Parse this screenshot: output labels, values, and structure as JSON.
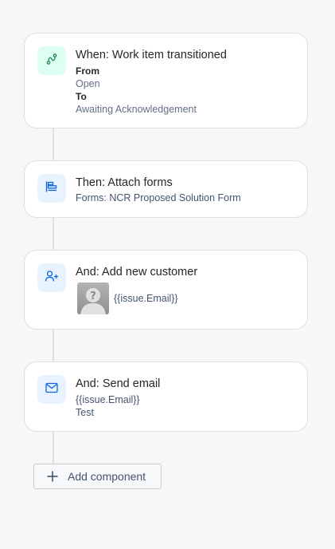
{
  "steps": [
    {
      "title": "When: Work item transitioned",
      "from_label": "From",
      "from_value": "Open",
      "to_label": "To",
      "to_value": "Awaiting Acknowledgement",
      "icon": "transition-icon"
    },
    {
      "title": "Then: Attach forms",
      "detail": "Forms: NCR Proposed Solution Form",
      "icon": "forms-icon"
    },
    {
      "title": "And: Add new customer",
      "detail": "{{issue.Email}}",
      "icon": "add-user-icon",
      "avatar": "default-avatar-icon"
    },
    {
      "title": "And: Send email",
      "recipient": "{{issue.Email}}",
      "subject": "Test",
      "icon": "mail-icon"
    }
  ],
  "add_component": {
    "label": "Add component",
    "icon": "plus-icon"
  },
  "colors": {
    "trigger_icon": "#1f845a",
    "action_icon": "#0c66e4",
    "trigger_bg": "#dcfff1",
    "action_bg": "#e9f2ff"
  }
}
